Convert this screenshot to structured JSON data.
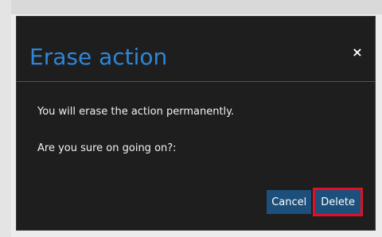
{
  "dialog": {
    "title": "Erase action",
    "close_glyph": "×",
    "message_line1": "You will erase the action permanently.",
    "message_line2": "Are you sure on going on?:"
  },
  "footer": {
    "cancel_label": "Cancel",
    "delete_label": "Delete"
  },
  "colors": {
    "title": "#2f86d8",
    "dialog_background": "#1e1e1e",
    "button_background": "#1c4f7b",
    "highlight_outline": "#e0102a"
  },
  "icons": {
    "close": "close-icon"
  }
}
